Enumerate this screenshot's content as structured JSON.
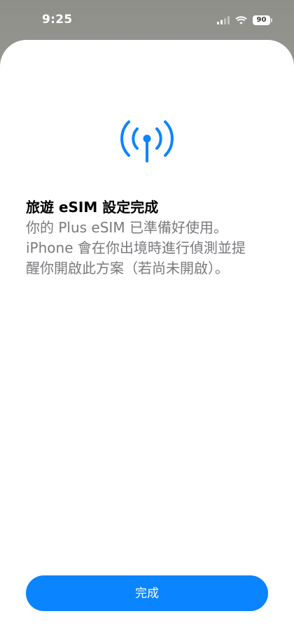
{
  "status_bar": {
    "time": "9:25",
    "battery": "90",
    "icons": [
      "signal-icon",
      "wifi-icon",
      "battery-icon"
    ]
  },
  "sheet": {
    "icon": "antenna-signal-icon",
    "title": "旅遊 eSIM 設定完成",
    "body_lines": [
      "你的 Plus eSIM 已準備好使用。",
      "iPhone 會在你出境時進行偵測並提",
      "醒你開啟此方案（若尚未開啟）。"
    ],
    "done_label": "完成"
  },
  "colors": {
    "accent": "#0a84ff",
    "title": "#000000",
    "body": "#7a7a7e"
  }
}
